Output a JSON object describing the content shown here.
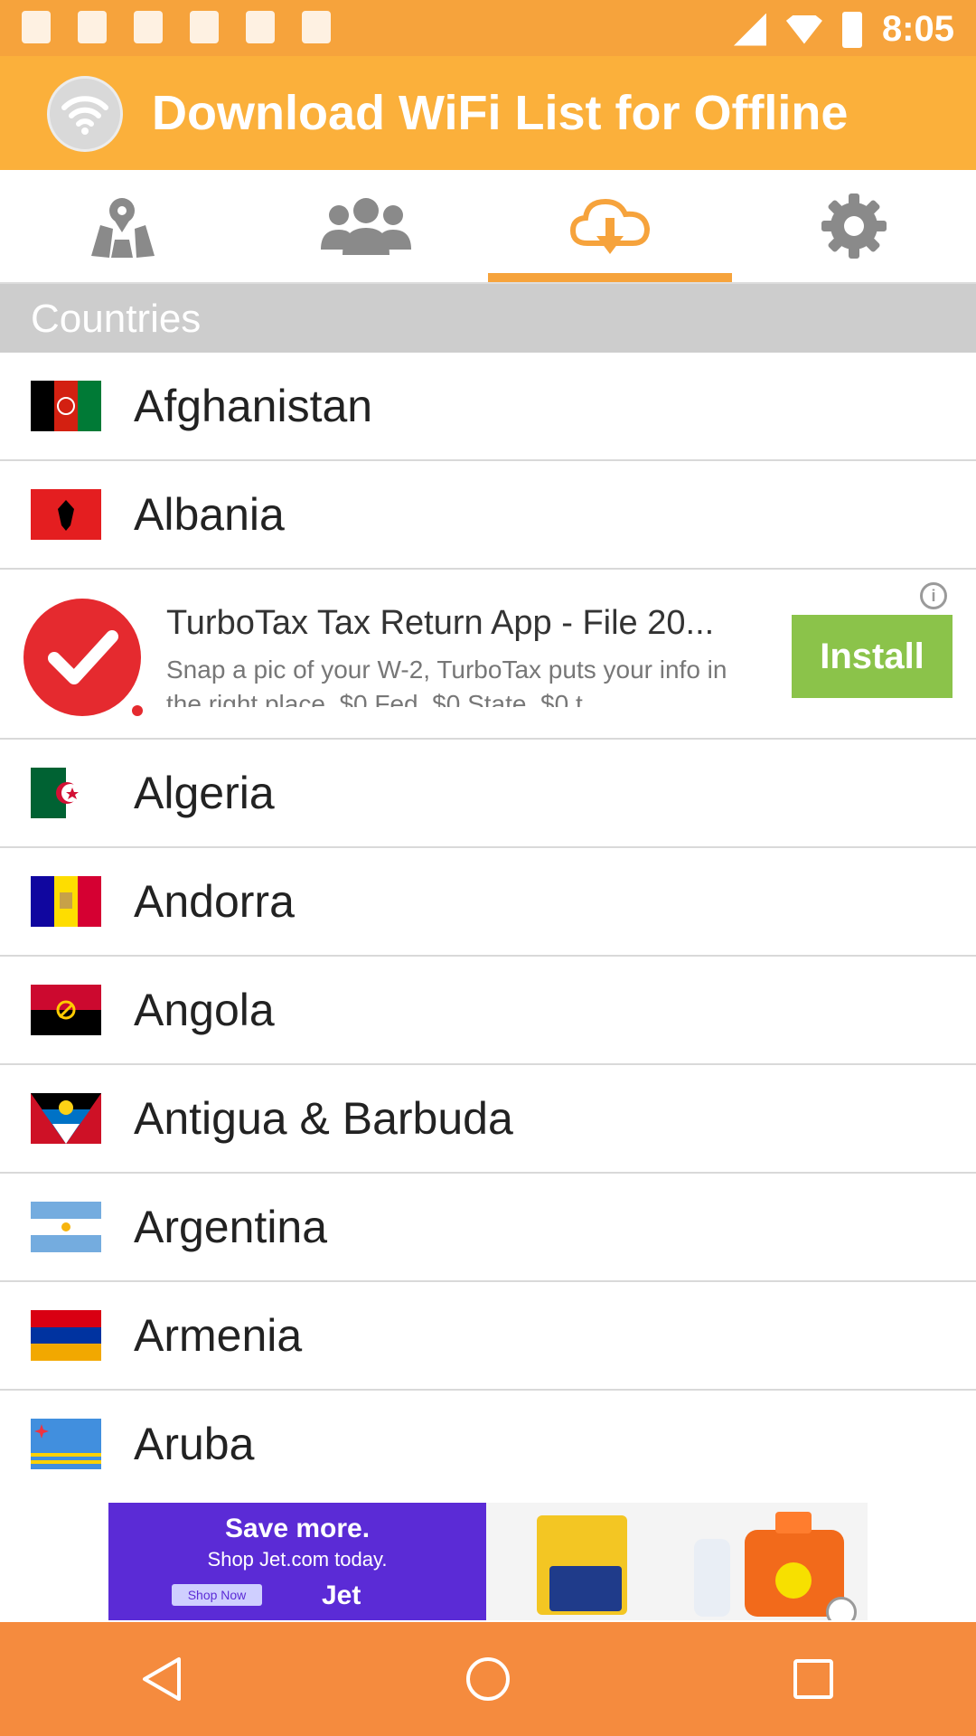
{
  "status_bar": {
    "time": "8:05",
    "left_icons": [
      "facebook-icon",
      "facebook-icon",
      "alert-icon",
      "location-off-icon",
      "lock-icon",
      "android-icon"
    ],
    "right_icons": [
      "signal-icon",
      "wifi-icon",
      "battery-icon"
    ]
  },
  "app_bar": {
    "title": "Download WiFi List for Offline",
    "logo_icon": "wifi-icon",
    "color": "#fbb03b"
  },
  "tabs": [
    {
      "icon": "map-icon",
      "active": false
    },
    {
      "icon": "people-icon",
      "active": false
    },
    {
      "icon": "cloud-download-icon",
      "active": true
    },
    {
      "icon": "gear-icon",
      "active": false
    }
  ],
  "section": {
    "label": "Countries"
  },
  "countries": [
    {
      "name": "Afghanistan",
      "flag": "afghanistan-flag-icon"
    },
    {
      "name": "Albania",
      "flag": "albania-flag-icon"
    },
    {
      "name": "Algeria",
      "flag": "algeria-flag-icon"
    },
    {
      "name": "Andorra",
      "flag": "andorra-flag-icon"
    },
    {
      "name": "Angola",
      "flag": "angola-flag-icon"
    },
    {
      "name": "Antigua & Barbuda",
      "flag": "antigua-barbuda-flag-icon"
    },
    {
      "name": "Argentina",
      "flag": "argentina-flag-icon"
    },
    {
      "name": "Armenia",
      "flag": "armenia-flag-icon"
    },
    {
      "name": "Aruba",
      "flag": "aruba-flag-icon"
    }
  ],
  "ad": {
    "title": "TurboTax Tax Return App - File 20...",
    "body": "Snap a pic of your W-2, TurboTax puts your info in the right place. $0 Fed, $0 State, $0 t",
    "install_label": "Install",
    "icon": "checkmark-icon"
  },
  "banner": {
    "line1": "Save more.",
    "line2": "Shop Jet.com today.",
    "button": "Shop Now",
    "brand": "Jet"
  },
  "nav": [
    "back-icon",
    "home-icon",
    "recents-icon"
  ],
  "colors": {
    "accent": "#f6a33c",
    "install": "#8bc34a",
    "navbar": "#f58b3e"
  }
}
